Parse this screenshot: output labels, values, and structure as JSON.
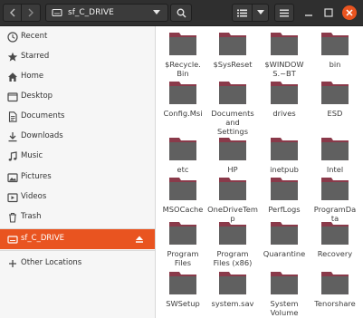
{
  "header": {
    "location": "sf_C_DRIVE"
  },
  "sidebar": {
    "items": [
      {
        "label": "Recent",
        "icon": "clock-icon"
      },
      {
        "label": "Starred",
        "icon": "star-icon"
      },
      {
        "label": "Home",
        "icon": "home-icon"
      },
      {
        "label": "Desktop",
        "icon": "desktop-folder-icon"
      },
      {
        "label": "Documents",
        "icon": "documents-folder-icon"
      },
      {
        "label": "Downloads",
        "icon": "download-icon"
      },
      {
        "label": "Music",
        "icon": "music-icon"
      },
      {
        "label": "Pictures",
        "icon": "pictures-icon"
      },
      {
        "label": "Videos",
        "icon": "videos-icon"
      },
      {
        "label": "Trash",
        "icon": "trash-icon"
      }
    ],
    "drive": {
      "label": "sf_C_DRIVE",
      "icon": "drive-icon",
      "active": true
    },
    "other": {
      "label": "Other Locations",
      "icon": "plus-icon"
    }
  },
  "files": [
    {
      "line1": "$Recycle.",
      "line2": "Bin"
    },
    {
      "line1": "$SysReset",
      "line2": ""
    },
    {
      "line1": "$WINDOW",
      "line2": "S.~BT"
    },
    {
      "line1": "bin",
      "line2": ""
    },
    {
      "line1": "Config.Msi",
      "line2": ""
    },
    {
      "line1": "Documents",
      "line2": "and",
      "line3": "Settings"
    },
    {
      "line1": "drives",
      "line2": ""
    },
    {
      "line1": "ESD",
      "line2": ""
    },
    {
      "line1": "etc",
      "line2": ""
    },
    {
      "line1": "HP",
      "line2": ""
    },
    {
      "line1": "inetpub",
      "line2": ""
    },
    {
      "line1": "Intel",
      "line2": ""
    },
    {
      "line1": "MSOCache",
      "line2": ""
    },
    {
      "line1": "OneDriveTem",
      "line2": "p"
    },
    {
      "line1": "PerfLogs",
      "line2": ""
    },
    {
      "line1": "ProgramDa",
      "line2": "ta"
    },
    {
      "line1": "Program",
      "line2": "Files"
    },
    {
      "line1": "Program",
      "line2": "Files (x86)"
    },
    {
      "line1": "Quarantine",
      "line2": ""
    },
    {
      "line1": "Recovery",
      "line2": ""
    },
    {
      "line1": "SWSetup",
      "line2": ""
    },
    {
      "line1": "system.sav",
      "line2": ""
    },
    {
      "line1": "System",
      "line2": "Volume"
    },
    {
      "line1": "Tenorshare",
      "line2": ""
    }
  ],
  "colors": {
    "accent": "#e95420",
    "folder_body": "#606060",
    "folder_tab": "#8a3a4a"
  }
}
